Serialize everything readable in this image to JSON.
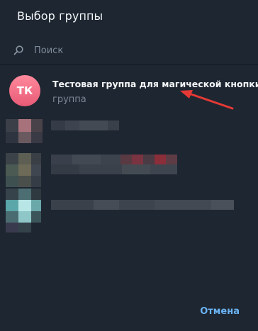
{
  "dialog": {
    "title": "Выбор группы",
    "search": {
      "placeholder": "Поиск",
      "value": ""
    },
    "groups": [
      {
        "initials": "ТК",
        "name": "Тестовая группа для магической кнопки",
        "subtitle": "группа"
      }
    ],
    "cancel_label": "Отмена"
  },
  "colors": {
    "background": "#1e2631",
    "accent": "#6ab3f3",
    "avatar_top": "#ff8a9c",
    "avatar_bottom": "#e85a76",
    "arrow": "#e53935"
  },
  "icons": {
    "search": "search-icon",
    "annotation": "red-arrow-icon"
  }
}
